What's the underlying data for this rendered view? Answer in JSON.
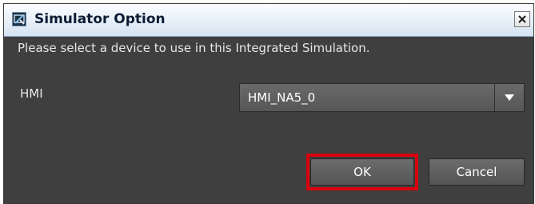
{
  "window": {
    "title": "Simulator Option",
    "close_glyph": "✕"
  },
  "dialog": {
    "message": "Please select a device to use in this Integrated Simulation.",
    "device_label": "HMI",
    "device_select": {
      "selected_value": "HMI_NA5_0"
    }
  },
  "buttons": {
    "ok_label": "OK",
    "cancel_label": "Cancel"
  },
  "icons": {
    "app": "simulator-app-icon",
    "close": "close-icon",
    "dropdown": "chevron-down-icon"
  },
  "colors": {
    "dialog_background": "#3f3f3f",
    "highlight_border": "#d9000d",
    "text": "#e6e6e6"
  }
}
